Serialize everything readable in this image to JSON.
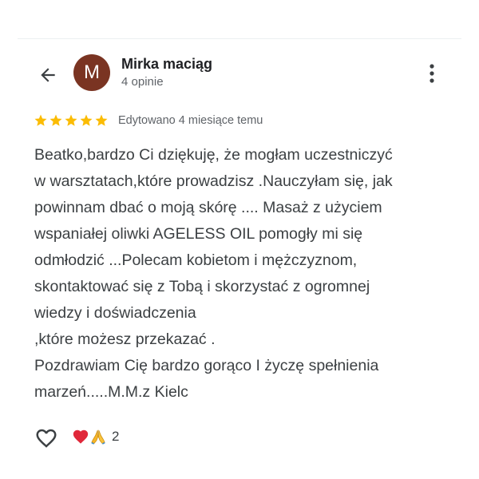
{
  "header": {
    "avatar_letter": "M",
    "user_name": "Mirka maciąg",
    "review_count": "4 opinie",
    "avatar_color": "#7a3422"
  },
  "review": {
    "rating": 5,
    "max_rating": 5,
    "star_color": "#fbbc04",
    "edited_label": "Edytowano 4 miesiące temu",
    "text": "Beatko,bardzo Ci dziękuję, że mogłam uczestniczyć\nw warsztatach,które prowadzisz .Nauczyłam się, jak\npowinnam dbać o moją skórę .... Masaż z użyciem\nwspaniałej oliwki AGELESS OIL pomogły mi się\nodmłodzić ...Polecam kobietom i mężczyznom,\nskontaktować się z Tobą i skorzystać z ogromnej\nwiedzy i doświadczenia\n,które możesz przekazać .\nPozdrawiam Cię bardzo gorąco I życzę spełnienia\nmarzeń.....M.M.z Kielc"
  },
  "footer": {
    "reactions": [
      "heart",
      "folded-hands"
    ],
    "reaction_count": "2"
  },
  "icons": {
    "back": "arrow-back-icon",
    "more": "more-vert-icon",
    "like": "heart-outline-icon"
  }
}
